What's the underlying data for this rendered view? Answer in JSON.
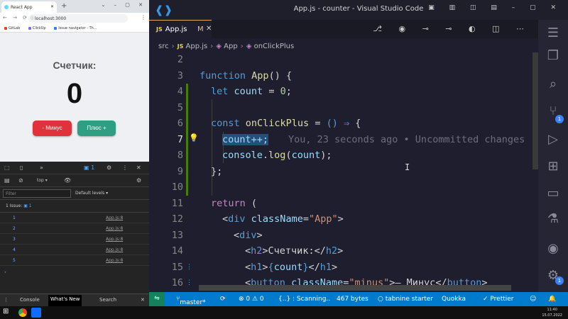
{
  "browser": {
    "tab_title": "React App",
    "url": "localhost:3000",
    "bookmarks": [
      "GitLab",
      "ClickUp",
      "Issue navigator - Th..."
    ]
  },
  "app": {
    "heading": "Счетчик:",
    "count": "0",
    "minus_label": "- Минус",
    "plus_label": "Плюс +"
  },
  "devtools": {
    "issues_badge": "1",
    "context": "top",
    "filter_placeholder": "Filter",
    "levels": "Default levels",
    "issue_text": "1 Issue:",
    "issue_count": "1",
    "logs": [
      {
        "value": "1",
        "src": "App.js:8"
      },
      {
        "value": "2",
        "src": "App.js:8"
      },
      {
        "value": "3",
        "src": "App.js:8"
      },
      {
        "value": "4",
        "src": "App.js:8"
      },
      {
        "value": "5",
        "src": "App.js:8"
      }
    ],
    "drawer_tabs": [
      "Console",
      "What's New",
      "Search"
    ]
  },
  "vscode": {
    "window_title": "App.js - counter - Visual Studio Code",
    "tab": {
      "lang": "JS",
      "name": "App.js",
      "modified": "M"
    },
    "breadcrumb": {
      "folder": "src",
      "lang": "JS",
      "file": "App.js",
      "sym1": "App",
      "sym2": "onClickPlus"
    },
    "blame": "You, 23 seconds ago • Uncommitted changes",
    "line_numbers": [
      "2",
      "3",
      "4",
      "5",
      "6",
      "7",
      "8",
      "9",
      "10",
      "11",
      "12",
      "13",
      "14",
      "15",
      "16"
    ],
    "activity_badges": [
      "1",
      "1"
    ],
    "status": {
      "branch": "master*",
      "problems": "⊗ 0 ⚠ 0",
      "scanning": "{..} : Scanning..",
      "size": "467 bytes",
      "tabnine": "○ tabnine starter",
      "quokka": "Quokka",
      "prettier": "✓ Prettier"
    }
  },
  "taskbar": {
    "time": "11:40",
    "date": "15.07.2022"
  }
}
